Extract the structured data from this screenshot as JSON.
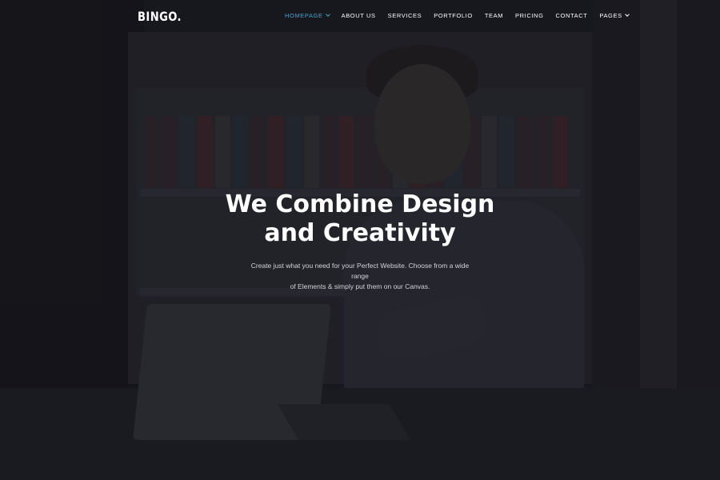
{
  "brand": {
    "logo": "BINGO."
  },
  "nav": {
    "items": [
      {
        "label": "HOMEPAGE",
        "active": true,
        "has_dropdown": true
      },
      {
        "label": "ABOUT US",
        "active": false,
        "has_dropdown": false
      },
      {
        "label": "SERVICES",
        "active": false,
        "has_dropdown": false
      },
      {
        "label": "PORTFOLIO",
        "active": false,
        "has_dropdown": false
      },
      {
        "label": "TEAM",
        "active": false,
        "has_dropdown": false
      },
      {
        "label": "PRICING",
        "active": false,
        "has_dropdown": false
      },
      {
        "label": "CONTACT",
        "active": false,
        "has_dropdown": false
      },
      {
        "label": "PAGES",
        "active": false,
        "has_dropdown": true
      }
    ],
    "active_color": "#4aa3c8"
  },
  "hero": {
    "headline_line1": "We Combine Design",
    "headline_line2": "and Creativity",
    "subtext_line1": "Create just what you need for your Perfect Website. Choose from a wide range",
    "subtext_line2": "of Elements & simply put them on our Canvas."
  },
  "colors": {
    "text": "#ffffff",
    "background": "#1d1d24"
  }
}
